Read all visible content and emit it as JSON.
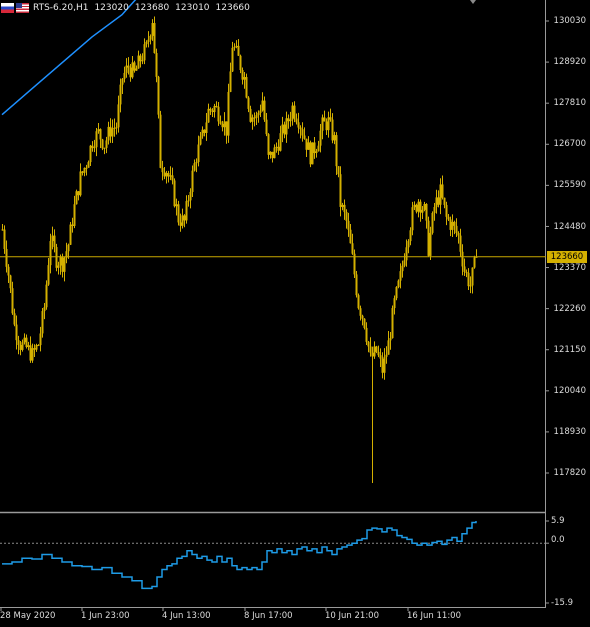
{
  "header": {
    "symbol": "RTS-6.20,H1",
    "ohlc": [
      "123020",
      "123680",
      "123010",
      "123660"
    ]
  },
  "price_axis": {
    "labels": [
      "130030",
      "128920",
      "127810",
      "126700",
      "125590",
      "124480",
      "123370",
      "122260",
      "121150",
      "120040",
      "118930",
      "117820"
    ],
    "current_price": "123660"
  },
  "indicator_axis": {
    "labels": [
      "5.9",
      "0.0",
      "-15.9"
    ]
  },
  "time_axis": {
    "labels": [
      "28 May 2020",
      "1 Jun 23:00",
      "4 Jun 13:00",
      "8 Jun 17:00",
      "10 Jun 21:00",
      "16 Jun 11:00"
    ]
  },
  "colors": {
    "background": "#000000",
    "candles": "#d4b000",
    "moving_average": "#1e90ff",
    "current_price_line": "#c8a800",
    "indicator": "#1e9be6",
    "grid_text": "#dcdcdc"
  },
  "chart_data": [
    {
      "type": "candlestick",
      "title": "RTS-6.20,H1",
      "ylim": [
        117100,
        131100
      ],
      "y_ticks": [
        130030,
        128920,
        127810,
        126700,
        125590,
        124480,
        123370,
        122260,
        121150,
        120040,
        118930,
        117820
      ],
      "current_price": 123660,
      "x_ticks": [
        "28 May 2020",
        "1 Jun 23:00",
        "4 Jun 13:00",
        "8 Jun 17:00",
        "10 Jun 21:00",
        "16 Jun 11:00"
      ],
      "close_path": [
        [
          0,
          124400
        ],
        [
          6,
          123200
        ],
        [
          12,
          121800
        ],
        [
          18,
          121300
        ],
        [
          24,
          121200
        ],
        [
          30,
          121000
        ],
        [
          36,
          121300
        ],
        [
          42,
          122300
        ],
        [
          48,
          124200
        ],
        [
          54,
          123600
        ],
        [
          60,
          123500
        ],
        [
          66,
          124000
        ],
        [
          72,
          125000
        ],
        [
          78,
          125800
        ],
        [
          84,
          126200
        ],
        [
          90,
          126800
        ],
        [
          96,
          127000
        ],
        [
          102,
          126700
        ],
        [
          108,
          127100
        ],
        [
          114,
          127200
        ],
        [
          120,
          128500
        ],
        [
          126,
          128800
        ],
        [
          132,
          128600
        ],
        [
          138,
          129000
        ],
        [
          144,
          129300
        ],
        [
          150,
          130100
        ],
        [
          154,
          128400
        ],
        [
          158,
          126200
        ],
        [
          164,
          126000
        ],
        [
          170,
          125500
        ],
        [
          176,
          124700
        ],
        [
          182,
          124600
        ],
        [
          188,
          125600
        ],
        [
          194,
          126400
        ],
        [
          200,
          126900
        ],
        [
          206,
          127600
        ],
        [
          212,
          127700
        ],
        [
          218,
          127500
        ],
        [
          224,
          127100
        ],
        [
          230,
          129400
        ],
        [
          236,
          129000
        ],
        [
          242,
          128500
        ],
        [
          248,
          127500
        ],
        [
          254,
          127400
        ],
        [
          260,
          127900
        ],
        [
          266,
          126300
        ],
        [
          272,
          126500
        ],
        [
          278,
          126900
        ],
        [
          284,
          127200
        ],
        [
          290,
          127700
        ],
        [
          296,
          127400
        ],
        [
          302,
          126900
        ],
        [
          308,
          126400
        ],
        [
          314,
          126700
        ],
        [
          320,
          127200
        ],
        [
          326,
          127300
        ],
        [
          332,
          126800
        ],
        [
          338,
          125100
        ],
        [
          344,
          124600
        ],
        [
          350,
          123600
        ],
        [
          356,
          122400
        ],
        [
          362,
          121900
        ],
        [
          368,
          120900
        ],
        [
          374,
          121100
        ],
        [
          380,
          120600
        ],
        [
          386,
          121300
        ],
        [
          392,
          122400
        ],
        [
          398,
          123100
        ],
        [
          404,
          124100
        ],
        [
          410,
          124800
        ],
        [
          416,
          125200
        ],
        [
          422,
          124900
        ],
        [
          426,
          123900
        ],
        [
          432,
          125000
        ],
        [
          438,
          125400
        ],
        [
          444,
          124700
        ],
        [
          450,
          124500
        ],
        [
          456,
          124200
        ],
        [
          462,
          123300
        ],
        [
          468,
          122900
        ],
        [
          474,
          123660
        ]
      ],
      "wick_extremes": [
        {
          "x": 152,
          "high": 130150
        },
        {
          "x": 370,
          "low": 117550
        }
      ],
      "series": [
        {
          "name": "",
          "kind": "moving_average",
          "points": [
            [
              0,
              127500
            ],
            [
              30,
              128200
            ],
            [
              60,
              128900
            ],
            [
              90,
              129600
            ],
            [
              120,
              130200
            ],
            [
              140,
              130800
            ],
            [
              150,
              131100
            ]
          ]
        }
      ]
    },
    {
      "type": "line",
      "ylim": [
        -15.9,
        5.9
      ],
      "zero_line": 0.0,
      "values": [
        [
          0,
          -5.5
        ],
        [
          10,
          -5
        ],
        [
          20,
          -4
        ],
        [
          30,
          -4.2
        ],
        [
          40,
          -3
        ],
        [
          50,
          -4
        ],
        [
          60,
          -5
        ],
        [
          70,
          -6
        ],
        [
          80,
          -6.2
        ],
        [
          90,
          -7
        ],
        [
          100,
          -6.5
        ],
        [
          110,
          -8
        ],
        [
          120,
          -9
        ],
        [
          130,
          -10
        ],
        [
          140,
          -12
        ],
        [
          150,
          -11.5
        ],
        [
          155,
          -9
        ],
        [
          160,
          -7
        ],
        [
          165,
          -6
        ],
        [
          170,
          -5.5
        ],
        [
          175,
          -4
        ],
        [
          180,
          -3.5
        ],
        [
          185,
          -2
        ],
        [
          190,
          -3
        ],
        [
          195,
          -4
        ],
        [
          200,
          -3.5
        ],
        [
          205,
          -4.5
        ],
        [
          210,
          -5
        ],
        [
          215,
          -3.5
        ],
        [
          220,
          -5
        ],
        [
          225,
          -4
        ],
        [
          230,
          -6
        ],
        [
          235,
          -7
        ],
        [
          240,
          -6.5
        ],
        [
          245,
          -7
        ],
        [
          250,
          -6.5
        ],
        [
          255,
          -7
        ],
        [
          260,
          -5
        ],
        [
          265,
          -2
        ],
        [
          270,
          -2.5
        ],
        [
          275,
          -1.5
        ],
        [
          280,
          -2.5
        ],
        [
          285,
          -2
        ],
        [
          290,
          -3
        ],
        [
          295,
          -1.5
        ],
        [
          300,
          -1
        ],
        [
          305,
          -2
        ],
        [
          310,
          -1.5
        ],
        [
          315,
          -2.5
        ],
        [
          320,
          -1
        ],
        [
          325,
          -2
        ],
        [
          330,
          -3
        ],
        [
          335,
          -1.5
        ],
        [
          340,
          -1
        ],
        [
          345,
          -0.5
        ],
        [
          350,
          0
        ],
        [
          355,
          0.8
        ],
        [
          360,
          1.2
        ],
        [
          365,
          3.5
        ],
        [
          370,
          4
        ],
        [
          375,
          3.8
        ],
        [
          380,
          3
        ],
        [
          385,
          4
        ],
        [
          390,
          3.5
        ],
        [
          395,
          2
        ],
        [
          400,
          1.5
        ],
        [
          405,
          1
        ],
        [
          410,
          0
        ],
        [
          415,
          -0.5
        ],
        [
          420,
          0
        ],
        [
          425,
          -0.5
        ],
        [
          430,
          0.2
        ],
        [
          435,
          0.5
        ],
        [
          440,
          -0.3
        ],
        [
          445,
          0.8
        ],
        [
          450,
          1.5
        ],
        [
          455,
          0.5
        ],
        [
          460,
          2.5
        ],
        [
          465,
          4
        ],
        [
          470,
          5.5
        ],
        [
          474,
          5.9
        ]
      ]
    }
  ]
}
